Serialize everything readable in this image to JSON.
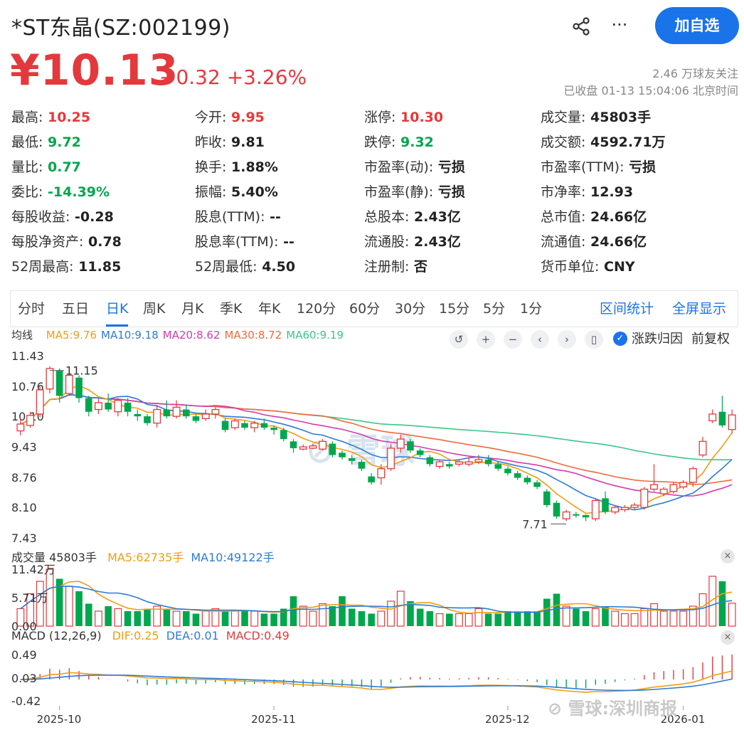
{
  "header": {
    "stock_name": "*ST东晶(SZ:002199)",
    "follow_label": "加自选",
    "price": "¥10.13",
    "change": "+0.32 +3.26%",
    "followers": "2.46 万球友关注",
    "timestamp": "已收盘 01-13 15:04:06 北京时间"
  },
  "quote": [
    [
      {
        "label": "最高:",
        "value": "10.25",
        "color": "up"
      },
      {
        "label": "今开:",
        "value": "9.95",
        "color": "up"
      },
      {
        "label": "涨停:",
        "value": "10.30",
        "color": "up"
      },
      {
        "label": "成交量:",
        "value": "45803手",
        "color": ""
      }
    ],
    [
      {
        "label": "最低:",
        "value": "9.72",
        "color": "down"
      },
      {
        "label": "昨收:",
        "value": "9.81",
        "color": ""
      },
      {
        "label": "跌停:",
        "value": "9.32",
        "color": "down"
      },
      {
        "label": "成交额:",
        "value": "4592.71万",
        "color": ""
      }
    ],
    [
      {
        "label": "量比:",
        "value": "0.77",
        "color": "down"
      },
      {
        "label": "换手:",
        "value": "1.88%",
        "color": ""
      },
      {
        "label": "市盈率(动):",
        "value": "亏损",
        "color": ""
      },
      {
        "label": "市盈率(TTM):",
        "value": "亏损",
        "color": ""
      }
    ],
    [
      {
        "label": "委比:",
        "value": "-14.39%",
        "color": "down"
      },
      {
        "label": "振幅:",
        "value": "5.40%",
        "color": ""
      },
      {
        "label": "市盈率(静):",
        "value": "亏损",
        "color": ""
      },
      {
        "label": "市净率:",
        "value": "12.93",
        "color": ""
      }
    ],
    [
      {
        "label": "每股收益:",
        "value": "-0.28",
        "color": ""
      },
      {
        "label": "股息(TTM):",
        "value": "--",
        "color": ""
      },
      {
        "label": "总股本:",
        "value": "2.43亿",
        "color": ""
      },
      {
        "label": "总市值:",
        "value": "24.66亿",
        "color": ""
      }
    ],
    [
      {
        "label": "每股净资产:",
        "value": "0.78",
        "color": ""
      },
      {
        "label": "股息率(TTM):",
        "value": "--",
        "color": ""
      },
      {
        "label": "流通股:",
        "value": "2.43亿",
        "color": ""
      },
      {
        "label": "流通值:",
        "value": "24.66亿",
        "color": ""
      }
    ],
    [
      {
        "label": "52周最高:",
        "value": "11.85",
        "color": ""
      },
      {
        "label": "52周最低:",
        "value": "4.50",
        "color": ""
      },
      {
        "label": "注册制:",
        "value": "否",
        "color": ""
      },
      {
        "label": "货币单位:",
        "value": "CNY",
        "color": ""
      }
    ]
  ],
  "tabs": [
    "分时",
    "五日",
    "日K",
    "周K",
    "月K",
    "季K",
    "年K",
    "120分",
    "60分",
    "30分",
    "15分",
    "5分",
    "1分"
  ],
  "active_tab": "日K",
  "tab_actions": [
    "区间统计",
    "全屏显示"
  ],
  "ma": {
    "title": "均线",
    "items": [
      {
        "label": "MA5:9.76",
        "color": "#f39c12"
      },
      {
        "label": "MA10:9.18",
        "color": "#2e7bd6"
      },
      {
        "label": "MA20:8.62",
        "color": "#d63ab0"
      },
      {
        "label": "MA30:8.72",
        "color": "#f06a3b"
      },
      {
        "label": "MA60:9.19",
        "color": "#3cc68a"
      }
    ],
    "checkbox_label": "涨跌归因",
    "adjust_label": "前复权"
  },
  "volume": {
    "title": "成交量 45803手",
    "items": [
      {
        "label": "MA5:62735手",
        "color": "#f39c12"
      },
      {
        "label": "MA10:49122手",
        "color": "#2e7bd6"
      }
    ],
    "axis": [
      "11.42万",
      "5.71万",
      "0.00"
    ]
  },
  "macd": {
    "title": "MACD (12,26,9)",
    "items": [
      {
        "label": "DIF:0.25",
        "color": "#f39c12"
      },
      {
        "label": "DEA:0.01",
        "color": "#2e7bd6"
      },
      {
        "label": "MACD:0.49",
        "color": "#e4393c"
      }
    ],
    "axis": [
      "0.49",
      "0.03",
      "-0.42"
    ]
  },
  "price_axis": [
    "11.43",
    "10.76",
    "10.10",
    "9.43",
    "8.76",
    "8.10",
    "7.43"
  ],
  "annotations": {
    "high": "11.15",
    "low": "7.71"
  },
  "dates": [
    "2025-10",
    "2025-11",
    "2025-12",
    "2026-01"
  ],
  "watermark": "雪球:深圳商报",
  "colors": {
    "up": "#e4393c",
    "down": "#00a74d",
    "accent": "#1a73e8"
  },
  "chart_data": {
    "type": "candlestick",
    "ylim": [
      7.43,
      11.43
    ],
    "candles": [
      [
        9.78,
        9.93,
        10.05,
        9.68
      ],
      [
        9.9,
        10.12,
        10.2,
        9.85
      ],
      [
        10.15,
        10.68,
        10.76,
        10.08
      ],
      [
        10.7,
        11.15,
        11.2,
        10.6
      ],
      [
        11.1,
        10.55,
        11.15,
        10.4
      ],
      [
        10.6,
        11.0,
        11.15,
        10.55
      ],
      [
        10.95,
        10.5,
        11.0,
        10.4
      ],
      [
        10.5,
        10.2,
        10.55,
        10.1
      ],
      [
        10.25,
        10.4,
        10.48,
        10.15
      ],
      [
        10.4,
        10.25,
        10.6,
        10.2
      ],
      [
        10.2,
        10.45,
        10.5,
        10.1
      ],
      [
        10.4,
        10.2,
        10.5,
        10.1
      ],
      [
        10.15,
        10.1,
        10.25,
        10.0
      ],
      [
        10.1,
        9.95,
        10.15,
        9.9
      ],
      [
        9.95,
        10.25,
        10.35,
        9.85
      ],
      [
        10.25,
        10.1,
        10.45,
        10.05
      ],
      [
        10.1,
        10.3,
        10.45,
        10.05
      ],
      [
        10.25,
        10.1,
        10.35,
        10.05
      ],
      [
        10.1,
        10.0,
        10.15,
        9.95
      ],
      [
        10.05,
        10.15,
        10.25,
        10.0
      ],
      [
        10.15,
        10.25,
        10.3,
        10.05
      ],
      [
        10.0,
        9.8,
        10.05,
        9.75
      ],
      [
        9.85,
        10.0,
        10.05,
        9.8
      ],
      [
        9.95,
        9.85,
        10.0,
        9.8
      ],
      [
        9.85,
        9.95,
        10.0,
        9.75
      ],
      [
        9.95,
        9.85,
        10.05,
        9.8
      ],
      [
        9.85,
        9.8,
        9.9,
        9.7
      ],
      [
        9.8,
        9.6,
        9.85,
        9.55
      ],
      [
        9.55,
        9.4,
        9.6,
        9.3
      ],
      [
        9.38,
        9.43,
        9.48,
        9.35
      ],
      [
        9.4,
        9.45,
        9.5,
        9.38
      ],
      [
        9.38,
        9.55,
        9.6,
        9.35
      ],
      [
        9.5,
        9.25,
        9.55,
        9.2
      ],
      [
        9.3,
        9.2,
        9.35,
        9.15
      ],
      [
        9.18,
        9.12,
        9.25,
        9.05
      ],
      [
        9.1,
        8.95,
        9.15,
        8.9
      ],
      [
        8.78,
        8.65,
        8.85,
        8.6
      ],
      [
        8.75,
        8.95,
        9.05,
        8.6
      ],
      [
        8.95,
        9.4,
        9.5,
        8.9
      ],
      [
        9.4,
        9.6,
        9.7,
        9.3
      ],
      [
        9.55,
        9.35,
        9.6,
        9.3
      ],
      [
        9.35,
        9.25,
        9.4,
        9.2
      ],
      [
        9.2,
        9.05,
        9.25,
        9.0
      ],
      [
        9.0,
        9.1,
        9.15,
        8.95
      ],
      [
        9.05,
        9.0,
        9.1,
        8.95
      ],
      [
        9.05,
        9.1,
        9.15,
        9.0
      ],
      [
        9.05,
        9.1,
        9.2,
        9.0
      ],
      [
        9.1,
        9.15,
        9.25,
        9.05
      ],
      [
        9.15,
        9.05,
        9.25,
        9.0
      ],
      [
        9.05,
        8.95,
        9.1,
        8.9
      ],
      [
        8.95,
        8.85,
        9.0,
        8.8
      ],
      [
        8.85,
        8.75,
        8.9,
        8.7
      ],
      [
        8.75,
        8.65,
        8.8,
        8.6
      ],
      [
        8.65,
        8.55,
        8.7,
        8.5
      ],
      [
        8.45,
        8.15,
        8.5,
        8.1
      ],
      [
        8.2,
        7.9,
        8.25,
        7.85
      ],
      [
        7.85,
        8.0,
        8.05,
        7.8
      ],
      [
        7.95,
        7.92,
        8.0,
        7.88
      ],
      [
        7.93,
        7.88,
        7.95,
        7.8
      ],
      [
        7.85,
        8.25,
        8.3,
        7.8
      ],
      [
        8.3,
        8.0,
        8.45,
        7.95
      ],
      [
        8.0,
        8.1,
        8.15,
        7.95
      ],
      [
        8.05,
        8.1,
        8.15,
        8.0
      ],
      [
        8.1,
        8.15,
        8.2,
        8.05
      ],
      [
        8.1,
        8.5,
        8.55,
        8.05
      ],
      [
        8.5,
        8.6,
        9.05,
        8.45
      ],
      [
        8.4,
        8.5,
        8.55,
        8.35
      ],
      [
        8.45,
        8.6,
        8.65,
        8.4
      ],
      [
        8.55,
        8.65,
        8.7,
        8.5
      ],
      [
        8.65,
        8.95,
        9.0,
        8.55
      ],
      [
        9.25,
        9.55,
        9.65,
        9.2
      ],
      [
        10.0,
        10.15,
        10.25,
        9.95
      ],
      [
        10.2,
        9.9,
        10.55,
        9.85
      ],
      [
        9.81,
        10.13,
        10.25,
        9.72
      ]
    ],
    "volume_ylim": [
      0,
      11.42
    ],
    "volumes": [
      3.5,
      6.5,
      9.0,
      11.4,
      9.5,
      8.0,
      7.0,
      4.5,
      3.0,
      4.0,
      3.5,
      3.0,
      3.0,
      3.5,
      4.0,
      3.5,
      3.0,
      3.0,
      2.5,
      3.0,
      3.5,
      3.0,
      3.0,
      3.0,
      3.0,
      2.5,
      2.5,
      3.5,
      6.0,
      4.0,
      3.0,
      4.5,
      4.0,
      6.0,
      3.5,
      3.0,
      2.5,
      3.0,
      5.0,
      7.0,
      5.0,
      3.5,
      3.0,
      2.5,
      2.5,
      2.5,
      2.5,
      3.5,
      2.5,
      2.5,
      3.0,
      3.0,
      3.0,
      3.0,
      5.5,
      6.5,
      4.0,
      3.5,
      3.0,
      3.5,
      4.0,
      3.0,
      2.5,
      2.5,
      3.5,
      4.5,
      3.0,
      3.0,
      3.0,
      4.0,
      6.5,
      10.0,
      9.0,
      4.6
    ],
    "macd_ylim": [
      -0.42,
      0.49
    ]
  }
}
